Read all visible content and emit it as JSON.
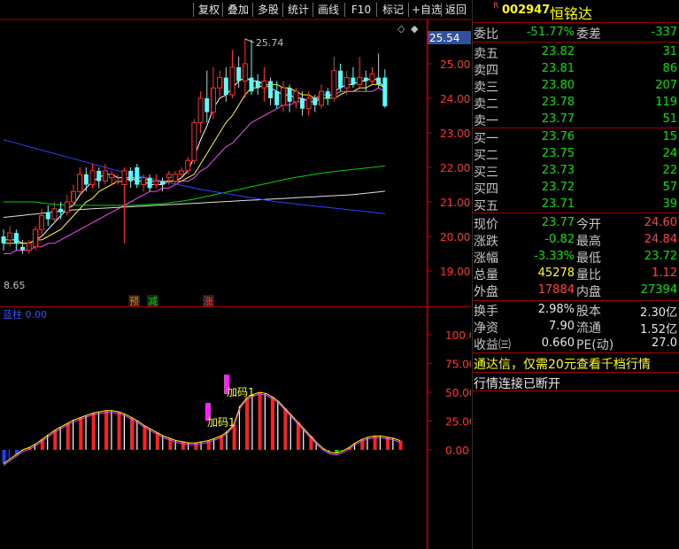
{
  "toolbar": {
    "buttons": [
      "复权",
      "叠加",
      "多股",
      "统计",
      "画线",
      "F10",
      "标记",
      "+自选",
      "返回"
    ]
  },
  "kline": {
    "y_ticks": [
      "25.00",
      "24.00",
      "23.00",
      "22.00",
      "21.00",
      "20.00",
      "19.00"
    ],
    "current_price_label": "25.54",
    "high_annotation": "25.74",
    "low_annotation": "8.65",
    "markers": [
      {
        "text": "预",
        "color": "#ff8000"
      },
      {
        "text": "减",
        "color": "#00d000"
      },
      {
        "text": "涨",
        "color": "#ff4040"
      }
    ],
    "candles": [
      {
        "o": 20.0,
        "c": 19.8,
        "h": 20.2,
        "l": 19.6
      },
      {
        "o": 19.9,
        "c": 20.1,
        "h": 20.3,
        "l": 19.7
      },
      {
        "o": 20.1,
        "c": 19.8,
        "h": 20.2,
        "l": 19.6
      },
      {
        "o": 19.7,
        "c": 19.6,
        "h": 19.9,
        "l": 19.5
      },
      {
        "o": 19.6,
        "c": 19.8,
        "h": 19.9,
        "l": 19.5
      },
      {
        "o": 19.7,
        "c": 20.2,
        "h": 20.3,
        "l": 19.6
      },
      {
        "o": 20.2,
        "c": 20.6,
        "h": 20.8,
        "l": 20.0
      },
      {
        "o": 20.7,
        "c": 20.5,
        "h": 20.9,
        "l": 20.3
      },
      {
        "o": 20.5,
        "c": 20.8,
        "h": 21.0,
        "l": 20.4
      },
      {
        "o": 20.8,
        "c": 20.7,
        "h": 21.0,
        "l": 20.5
      },
      {
        "o": 20.7,
        "c": 21.0,
        "h": 21.2,
        "l": 20.6
      },
      {
        "o": 21.0,
        "c": 21.3,
        "h": 21.5,
        "l": 20.9
      },
      {
        "o": 21.3,
        "c": 21.8,
        "h": 22.0,
        "l": 21.2
      },
      {
        "o": 21.8,
        "c": 21.5,
        "h": 22.0,
        "l": 21.3
      },
      {
        "o": 21.5,
        "c": 21.9,
        "h": 22.1,
        "l": 21.4
      },
      {
        "o": 21.9,
        "c": 21.6,
        "h": 22.0,
        "l": 21.4
      },
      {
        "o": 21.6,
        "c": 21.9,
        "h": 22.1,
        "l": 21.5
      },
      {
        "o": 21.7,
        "c": 21.8,
        "h": 21.9,
        "l": 21.5
      },
      {
        "o": 21.6,
        "c": 21.6,
        "h": 21.8,
        "l": 21.5
      },
      {
        "o": 21.5,
        "c": 21.9,
        "h": 22.0,
        "l": 19.8
      },
      {
        "o": 21.9,
        "c": 21.6,
        "h": 22.0,
        "l": 21.4
      },
      {
        "o": 22.0,
        "c": 21.5,
        "h": 22.1,
        "l": 21.4
      },
      {
        "o": 21.5,
        "c": 21.7,
        "h": 21.8,
        "l": 21.3
      },
      {
        "o": 21.7,
        "c": 21.4,
        "h": 21.8,
        "l": 21.3
      },
      {
        "o": 21.5,
        "c": 21.6,
        "h": 21.8,
        "l": 21.4
      },
      {
        "o": 21.6,
        "c": 21.5,
        "h": 21.7,
        "l": 21.3
      },
      {
        "o": 21.7,
        "c": 21.8,
        "h": 21.9,
        "l": 21.5
      },
      {
        "o": 21.6,
        "c": 21.8,
        "h": 21.9,
        "l": 21.5
      },
      {
        "o": 21.8,
        "c": 21.9,
        "h": 22.0,
        "l": 21.7
      },
      {
        "o": 21.9,
        "c": 22.2,
        "h": 22.3,
        "l": 21.8
      },
      {
        "o": 22.2,
        "c": 23.3,
        "h": 23.4,
        "l": 22.1
      },
      {
        "o": 23.3,
        "c": 24.0,
        "h": 24.2,
        "l": 23.0
      },
      {
        "o": 24.0,
        "c": 23.6,
        "h": 24.8,
        "l": 23.3
      },
      {
        "o": 23.6,
        "c": 24.3,
        "h": 24.9,
        "l": 23.4
      },
      {
        "o": 24.3,
        "c": 24.6,
        "h": 24.8,
        "l": 24.0
      },
      {
        "o": 24.6,
        "c": 24.1,
        "h": 24.9,
        "l": 23.9
      },
      {
        "o": 24.1,
        "c": 24.9,
        "h": 25.4,
        "l": 24.0
      },
      {
        "o": 24.9,
        "c": 24.5,
        "h": 25.2,
        "l": 24.3
      },
      {
        "o": 24.5,
        "c": 25.0,
        "h": 25.74,
        "l": 24.0
      },
      {
        "o": 24.6,
        "c": 24.2,
        "h": 25.7,
        "l": 24.1
      },
      {
        "o": 24.5,
        "c": 24.3,
        "h": 24.7,
        "l": 24.1
      },
      {
        "o": 24.3,
        "c": 24.5,
        "h": 24.9,
        "l": 23.9
      },
      {
        "o": 24.5,
        "c": 24.0,
        "h": 24.6,
        "l": 23.8
      },
      {
        "o": 24.2,
        "c": 23.8,
        "h": 24.5,
        "l": 23.7
      },
      {
        "o": 23.8,
        "c": 24.3,
        "h": 24.5,
        "l": 23.6
      },
      {
        "o": 24.3,
        "c": 23.9,
        "h": 24.4,
        "l": 23.6
      },
      {
        "o": 23.9,
        "c": 24.2,
        "h": 24.3,
        "l": 23.7
      },
      {
        "o": 24.0,
        "c": 23.7,
        "h": 24.2,
        "l": 23.5
      },
      {
        "o": 23.7,
        "c": 24.0,
        "h": 24.2,
        "l": 23.5
      },
      {
        "o": 24.0,
        "c": 23.8,
        "h": 24.1,
        "l": 23.6
      },
      {
        "o": 23.8,
        "c": 24.2,
        "h": 24.4,
        "l": 23.7
      },
      {
        "o": 24.2,
        "c": 24.0,
        "h": 24.3,
        "l": 23.8
      },
      {
        "o": 24.0,
        "c": 24.8,
        "h": 25.2,
        "l": 23.9
      },
      {
        "o": 24.8,
        "c": 24.3,
        "h": 25.0,
        "l": 24.2
      },
      {
        "o": 24.3,
        "c": 24.6,
        "h": 24.8,
        "l": 24.1
      },
      {
        "o": 24.6,
        "c": 24.4,
        "h": 24.9,
        "l": 24.3
      },
      {
        "o": 24.4,
        "c": 24.6,
        "h": 25.2,
        "l": 24.3
      },
      {
        "o": 24.6,
        "c": 24.5,
        "h": 24.8,
        "l": 24.2
      },
      {
        "o": 24.5,
        "c": 24.7,
        "h": 24.9,
        "l": 24.4
      },
      {
        "o": 24.6,
        "c": 24.4,
        "h": 25.3,
        "l": 24.3
      },
      {
        "o": 24.6,
        "c": 23.77,
        "h": 24.84,
        "l": 23.72
      }
    ],
    "ma_series": [
      {
        "name": "MA5",
        "color": "#ffffff",
        "values": [
          19.9,
          19.9,
          19.9,
          19.8,
          19.8,
          19.9,
          20.0,
          20.2,
          20.4,
          20.6,
          20.8,
          20.9,
          21.2,
          21.4,
          21.6,
          21.7,
          21.8,
          21.8,
          21.7,
          21.7,
          21.7,
          21.6,
          21.6,
          21.5,
          21.5,
          21.5,
          21.6,
          21.6,
          21.7,
          21.9,
          22.3,
          22.8,
          23.2,
          23.7,
          24.0,
          24.1,
          24.3,
          24.5,
          24.6,
          24.5,
          24.5,
          24.4,
          24.3,
          24.2,
          24.1,
          24.1,
          24.0,
          24.0,
          23.9,
          23.9,
          24.0,
          24.0,
          24.2,
          24.3,
          24.4,
          24.4,
          24.5,
          24.5,
          24.6,
          24.5,
          24.3
        ]
      },
      {
        "name": "MA10",
        "color": "#ffff00",
        "values": [
          19.8,
          19.8,
          19.8,
          19.8,
          19.8,
          19.9,
          19.9,
          20.0,
          20.1,
          20.2,
          20.4,
          20.6,
          20.8,
          21.0,
          21.1,
          21.3,
          21.4,
          21.5,
          21.6,
          21.6,
          21.7,
          21.7,
          21.7,
          21.6,
          21.6,
          21.6,
          21.6,
          21.6,
          21.6,
          21.7,
          21.8,
          22.1,
          22.4,
          22.7,
          23.0,
          23.3,
          23.5,
          23.8,
          24.1,
          24.3,
          24.3,
          24.4,
          24.4,
          24.4,
          24.3,
          24.3,
          24.2,
          24.1,
          24.1,
          24.0,
          24.0,
          24.0,
          24.0,
          24.1,
          24.2,
          24.2,
          24.3,
          24.3,
          24.4,
          24.4,
          24.3
        ]
      },
      {
        "name": "MA20",
        "color": "#ff40ff",
        "values": [
          19.5,
          19.5,
          19.6,
          19.6,
          19.6,
          19.7,
          19.7,
          19.8,
          19.8,
          19.9,
          20.0,
          20.1,
          20.2,
          20.3,
          20.4,
          20.5,
          20.6,
          20.7,
          20.8,
          20.9,
          21.0,
          21.1,
          21.2,
          21.3,
          21.3,
          21.4,
          21.4,
          21.5,
          21.6,
          21.6,
          21.7,
          21.9,
          22.0,
          22.2,
          22.4,
          22.6,
          22.7,
          22.9,
          23.1,
          23.3,
          23.4,
          23.5,
          23.6,
          23.7,
          23.8,
          23.8,
          23.9,
          23.9,
          24.0,
          24.0,
          24.1,
          24.1,
          24.1,
          24.2,
          24.2,
          24.2,
          24.2,
          24.2,
          24.2,
          24.3,
          24.2
        ]
      },
      {
        "name": "MA60",
        "color": "#00d000",
        "values": [
          21.0,
          21.0,
          21.0,
          21.0,
          21.0,
          21.0,
          20.97,
          20.95,
          20.93,
          20.92,
          20.91,
          20.9,
          20.9,
          20.9,
          20.9,
          20.9,
          20.9,
          20.9,
          20.9,
          20.9,
          20.9,
          20.91,
          20.92,
          20.93,
          20.94,
          20.95,
          20.97,
          21.0,
          21.02,
          21.05,
          21.08,
          21.12,
          21.16,
          21.2,
          21.24,
          21.28,
          21.32,
          21.36,
          21.4,
          21.44,
          21.48,
          21.52,
          21.56,
          21.6,
          21.64,
          21.68,
          21.71,
          21.74,
          21.77,
          21.8,
          21.83,
          21.86,
          21.88,
          21.9,
          21.92,
          21.94,
          21.96,
          21.98,
          22.0,
          22.02,
          22.04
        ]
      },
      {
        "name": "MA120",
        "color": "#e0e0e0",
        "values": [
          20.55,
          20.57,
          20.59,
          20.61,
          20.63,
          20.65,
          20.67,
          20.69,
          20.71,
          20.73,
          20.75,
          20.77,
          20.78,
          20.79,
          20.8,
          20.81,
          20.82,
          20.83,
          20.84,
          20.85,
          20.86,
          20.87,
          20.88,
          20.89,
          20.9,
          20.91,
          20.92,
          20.93,
          20.94,
          20.95,
          20.96,
          20.97,
          20.98,
          20.99,
          21.0,
          21.01,
          21.02,
          21.03,
          21.04,
          21.05,
          21.06,
          21.07,
          21.08,
          21.09,
          21.1,
          21.11,
          21.12,
          21.13,
          21.14,
          21.15,
          21.16,
          21.17,
          21.18,
          21.19,
          21.2,
          21.21,
          21.23,
          21.25,
          21.27,
          21.29,
          21.31
        ]
      },
      {
        "name": "MA250",
        "color": "#3040ff",
        "values": [
          22.8,
          22.75,
          22.7,
          22.65,
          22.6,
          22.55,
          22.5,
          22.45,
          22.4,
          22.35,
          22.3,
          22.25,
          22.2,
          22.15,
          22.1,
          22.05,
          22.0,
          21.95,
          21.9,
          21.85,
          21.8,
          21.76,
          21.72,
          21.68,
          21.64,
          21.6,
          21.56,
          21.52,
          21.48,
          21.44,
          21.4,
          21.36,
          21.33,
          21.3,
          21.27,
          21.24,
          21.21,
          21.18,
          21.15,
          21.12,
          21.09,
          21.06,
          21.03,
          21.0,
          20.98,
          20.96,
          20.94,
          20.92,
          20.9,
          20.88,
          20.86,
          20.84,
          20.82,
          20.8,
          20.78,
          20.76,
          20.74,
          20.72,
          20.7,
          20.68,
          20.66
        ]
      }
    ]
  },
  "indicator": {
    "title": "蓝柱 0.00",
    "y_ticks": [
      "100.0",
      "75.00",
      "50.00",
      "25.00",
      "0.00"
    ],
    "annotation_1": "加码1",
    "annotation_2": "加码1",
    "bars": [
      -12,
      -8,
      -4,
      0,
      2,
      5,
      9,
      13,
      17,
      20,
      23,
      26,
      28,
      30,
      32,
      33,
      34,
      34,
      33,
      31,
      28,
      25,
      21,
      18,
      15,
      12,
      10,
      8,
      7,
      6,
      6,
      7,
      8,
      10,
      12,
      16,
      22,
      38,
      45,
      48,
      50,
      49,
      46,
      42,
      36,
      30,
      24,
      18,
      12,
      6,
      1,
      -2,
      -3,
      -1,
      2,
      6,
      9,
      11,
      12,
      12,
      11,
      10,
      8
    ]
  },
  "stock": {
    "badge": "R",
    "code": "002947",
    "name": "恒铭达",
    "weibi_label": "委比",
    "weibi_value": "-51.77%",
    "weicha_label": "委差",
    "weicha_value": "-337",
    "asks": [
      {
        "label": "卖五",
        "price": "23.82",
        "vol": "31"
      },
      {
        "label": "卖四",
        "price": "23.81",
        "vol": "86"
      },
      {
        "label": "卖三",
        "price": "23.80",
        "vol": "207"
      },
      {
        "label": "卖二",
        "price": "23.78",
        "vol": "119"
      },
      {
        "label": "卖一",
        "price": "23.77",
        "vol": "51"
      }
    ],
    "bids": [
      {
        "label": "买一",
        "price": "23.76",
        "vol": "15"
      },
      {
        "label": "买二",
        "price": "23.75",
        "vol": "24"
      },
      {
        "label": "买三",
        "price": "23.73",
        "vol": "22"
      },
      {
        "label": "买四",
        "price": "23.72",
        "vol": "57"
      },
      {
        "label": "买五",
        "price": "23.71",
        "vol": "39"
      }
    ],
    "quote": [
      {
        "l1": "现价",
        "v1": "23.77",
        "c1": "green",
        "l2": "今开",
        "v2": "24.60",
        "c2": "red"
      },
      {
        "l1": "涨跌",
        "v1": "-0.82",
        "c1": "green",
        "l2": "最高",
        "v2": "24.84",
        "c2": "red"
      },
      {
        "l1": "涨幅",
        "v1": "-3.33%",
        "c1": "green",
        "l2": "最低",
        "v2": "23.72",
        "c2": "green"
      },
      {
        "l1": "总量",
        "v1": "45278",
        "c1": "yellow",
        "l2": "量比",
        "v2": "1.12",
        "c2": "red"
      },
      {
        "l1": "外盘",
        "v1": "17884",
        "c1": "red",
        "l2": "内盘",
        "v2": "27394",
        "c2": "green"
      }
    ],
    "fin": [
      {
        "l1": "换手",
        "v1": "2.98%",
        "l2": "股本",
        "v2": "2.30亿"
      },
      {
        "l1": "净资",
        "v1": "7.90",
        "l2": "流通",
        "v2": "1.52亿"
      },
      {
        "l1": "收益㈢",
        "v1": "0.660",
        "l2": "PE(动)",
        "v2": "27.0"
      }
    ],
    "promo": "通达信，仅需20元查看千档行情",
    "status": "行情连接已断开"
  }
}
